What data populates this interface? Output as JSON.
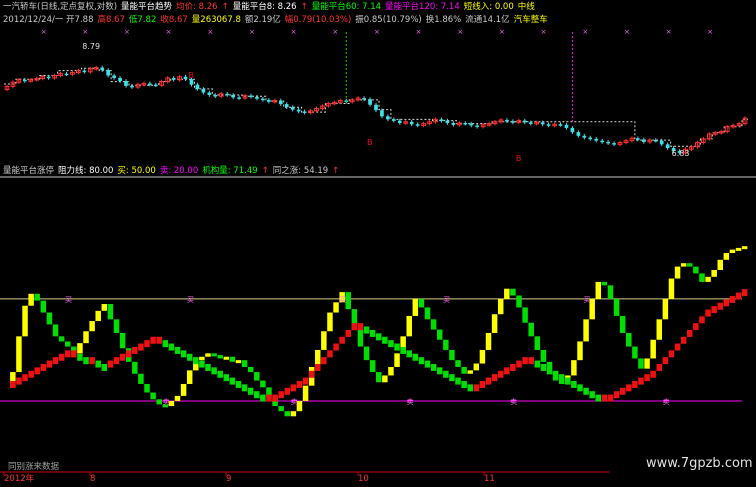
{
  "colors": {
    "background": "#000000",
    "up": "#ff3030",
    "down": "#40e0e8",
    "yellow": "#ffff00",
    "green": "#00dd00",
    "red": "#ee1111",
    "magenta": "#ff00ff",
    "pink": "#ff66ff",
    "resistance": "#d8d080",
    "divider": "#c8c8c8",
    "text": "#c0c0c0",
    "axis_red": "#cc0000"
  },
  "header": {
    "row1": [
      {
        "text": "一汽轿车(日线,定点复权,对数)",
        "color": "#c8c8c8"
      },
      {
        "text": "量能平台趋势",
        "color": "#ffffff"
      },
      {
        "text": "均价: 8.26",
        "color": "#ff3333"
      },
      {
        "text": "↑",
        "color": "#ff3333"
      },
      {
        "text": "量能平台8: 8.26",
        "color": "#ffffff"
      },
      {
        "text": "↑",
        "color": "#ff3333"
      },
      {
        "text": "量能平台60: 7.14",
        "color": "#00ff00"
      },
      {
        "text": "量能平台120: 7.14",
        "color": "#ff00ff"
      },
      {
        "text": "短线入: 0.00",
        "color": "#ffff00"
      },
      {
        "text": "中线",
        "color": "#ffff00"
      }
    ],
    "row2": [
      {
        "text": "2012/12/24/一 开7.88",
        "color": "#c8c8c8"
      },
      {
        "text": "高8.67",
        "color": "#ff3333"
      },
      {
        "text": "低7.82",
        "color": "#00ff00"
      },
      {
        "text": "收8.67",
        "color": "#ff3333"
      },
      {
        "text": "量263067.8",
        "color": "#ffff00"
      },
      {
        "text": "额2.19亿",
        "color": "#c8c8c8"
      },
      {
        "text": "幅0.79(10.03%)",
        "color": "#ff3333"
      },
      {
        "text": "振0.85(10.79%)",
        "color": "#c8c8c8"
      },
      {
        "text": "换1.86%",
        "color": "#c8c8c8"
      },
      {
        "text": "流通14.1亿",
        "color": "#c8c8c8"
      },
      {
        "text": "汽车整车",
        "color": "#ffff00"
      }
    ]
  },
  "lower_header": [
    {
      "text": "量能平台涨停",
      "color": "#c8c8c8"
    },
    {
      "text": "阻力线: 80.00",
      "color": "#ffffff"
    },
    {
      "text": "买: 50.00",
      "color": "#ffff00"
    },
    {
      "text": "卖: 20.00",
      "color": "#ff00ff"
    },
    {
      "text": "机构量: 71.49",
      "color": "#00ff00"
    },
    {
      "text": "↑",
      "color": "#ff3333"
    },
    {
      "text": "同之涨: 54.19",
      "color": "#c8c8c8"
    },
    {
      "text": "↑",
      "color": "#ff3333"
    }
  ],
  "annotations": {
    "price_high": "8.79",
    "price_low": "6.83",
    "signal_glyph": "B",
    "buy_glyph": "买",
    "sell_glyph": "卖",
    "bottom_left": "同别涨来数据",
    "watermark": "www.7gpzb.com",
    "x_ticks": [
      "2012年",
      "8",
      "9",
      "10",
      "11"
    ]
  },
  "chart_data": [
    {
      "type": "candlestick",
      "title": "一汽轿车(日线,定点复权,对数)",
      "x": "trading day index",
      "ylim": [
        6.7,
        8.9
      ],
      "close": [
        7.94,
        8.01,
        8.05,
        8.03,
        8.05,
        8.07,
        8.1,
        8.08,
        8.12,
        8.15,
        8.14,
        8.17,
        8.2,
        8.18,
        8.23,
        8.25,
        8.21,
        8.12,
        8.08,
        8.03,
        7.95,
        7.93,
        7.97,
        7.99,
        7.97,
        7.96,
        8.02,
        8.08,
        8.05,
        8.1,
        8.06,
        7.97,
        7.9,
        7.84,
        7.8,
        7.78,
        7.82,
        7.8,
        7.76,
        7.75,
        7.79,
        7.77,
        7.74,
        7.72,
        7.69,
        7.71,
        7.65,
        7.6,
        7.56,
        7.53,
        7.51,
        7.54,
        7.58,
        7.62,
        7.66,
        7.68,
        7.71,
        7.69,
        7.72,
        7.75,
        7.73,
        7.64,
        7.55,
        7.45,
        7.4,
        7.38,
        7.34,
        7.36,
        7.32,
        7.3,
        7.33,
        7.36,
        7.4,
        7.38,
        7.34,
        7.31,
        7.34,
        7.33,
        7.3,
        7.28,
        7.31,
        7.33,
        7.36,
        7.39,
        7.37,
        7.35,
        7.38,
        7.35,
        7.33,
        7.35,
        7.32,
        7.3,
        7.32,
        7.31,
        7.26,
        7.19,
        7.13,
        7.1,
        7.08,
        7.05,
        7.03,
        7.01,
        6.99,
        7.02,
        7.05,
        7.09,
        7.07,
        7.03,
        7.06,
        7.05,
        6.99,
        6.93,
        6.88,
        6.85,
        6.91,
        6.95,
        7.02,
        7.08,
        7.16,
        7.18,
        7.2,
        7.28,
        7.3,
        7.33,
        7.42
      ],
      "series": [
        {
          "name": "量能平台8",
          "values": [
            7.98,
            7.98,
            8.06,
            8.06,
            8.06,
            8.06,
            8.12,
            8.12,
            8.12,
            8.2,
            8.2,
            8.2,
            8.2,
            8.24,
            8.24,
            8.24,
            8.2,
            8.2,
            8.02,
            8.02,
            8.02,
            7.96,
            7.96,
            7.96,
            7.96,
            7.96,
            8.02,
            8.02,
            8.06,
            8.06,
            8.06,
            8.06,
            7.9,
            7.9,
            7.9,
            7.8,
            7.8,
            7.8,
            7.8,
            7.8,
            7.78,
            7.78,
            7.78,
            7.78,
            7.7,
            7.7,
            7.7,
            7.6,
            7.6,
            7.6,
            7.52,
            7.52,
            7.52,
            7.52,
            7.66,
            7.66,
            7.66,
            7.66,
            7.72,
            7.72,
            7.72,
            7.72,
            7.72,
            7.56,
            7.56,
            7.4,
            7.4,
            7.4,
            7.4,
            7.4,
            7.4,
            7.4,
            7.38,
            7.38,
            7.38,
            7.38,
            7.33,
            7.33,
            7.33,
            7.33,
            7.33,
            7.33,
            7.36,
            7.36,
            7.36,
            7.36,
            7.36,
            7.36,
            7.36,
            7.36,
            7.36,
            7.36,
            7.36,
            7.36,
            7.36,
            7.36,
            7.36,
            7.36,
            7.36,
            7.36,
            7.36,
            7.36,
            7.36,
            7.36,
            7.36,
            7.36,
            7.06,
            7.06,
            7.06,
            7.06,
            7.06,
            7.06,
            6.96,
            6.96,
            6.96,
            6.96,
            6.96,
            7.08,
            7.08,
            7.18,
            7.18,
            7.28,
            7.28,
            7.28,
            7.4
          ]
        }
      ]
    },
    {
      "type": "line",
      "title": "量能平台涨停",
      "ylim": [
        0,
        100
      ],
      "reference_lines": {
        "阻力线": 80,
        "买": 50,
        "卖": 20
      },
      "series": [
        {
          "name": "机构量",
          "values": [
            28,
            37,
            58,
            76,
            83,
            79,
            72,
            65,
            58,
            55,
            52,
            48,
            54,
            61,
            67,
            73,
            77,
            68,
            60,
            51,
            43,
            36,
            30,
            25,
            21,
            18,
            17,
            20,
            23,
            30,
            38,
            44,
            46,
            48,
            47,
            45,
            46,
            43,
            44,
            40,
            37,
            32,
            28,
            22,
            17,
            14,
            11,
            14,
            20,
            29,
            40,
            50,
            61,
            72,
            78,
            84,
            74,
            62,
            52,
            44,
            37,
            31,
            35,
            40,
            48,
            58,
            70,
            80,
            75,
            68,
            62,
            56,
            50,
            44,
            40,
            36,
            38,
            42,
            50,
            60,
            71,
            80,
            86,
            82,
            75,
            66,
            58,
            50,
            43,
            37,
            32,
            30,
            35,
            44,
            55,
            68,
            80,
            90,
            88,
            80,
            70,
            60,
            52,
            45,
            39,
            45,
            56,
            68,
            80,
            92,
            99,
            101,
            99,
            95,
            90,
            93,
            97,
            103,
            107,
            109,
            110,
            111
          ]
        },
        {
          "name": "同之涨",
          "values": [
            28,
            30,
            32,
            34,
            36,
            38,
            40,
            42,
            44,
            46,
            48,
            48,
            46,
            44,
            44,
            42,
            40,
            42,
            44,
            46,
            48,
            50,
            52,
            54,
            56,
            56,
            54,
            52,
            50,
            48,
            46,
            44,
            42,
            40,
            38,
            36,
            34,
            32,
            30,
            28,
            26,
            24,
            22,
            22,
            22,
            24,
            26,
            28,
            30,
            32,
            36,
            40,
            44,
            48,
            52,
            56,
            60,
            64,
            64,
            62,
            60,
            58,
            56,
            54,
            52,
            50,
            48,
            46,
            44,
            42,
            40,
            38,
            36,
            34,
            32,
            30,
            28,
            28,
            30,
            32,
            34,
            36,
            38,
            40,
            42,
            44,
            44,
            42,
            40,
            38,
            36,
            34,
            32,
            30,
            28,
            26,
            24,
            22,
            22,
            22,
            24,
            26,
            28,
            30,
            32,
            34,
            36,
            40,
            44,
            48,
            52,
            56,
            60,
            64,
            68,
            72,
            74,
            76,
            78,
            80,
            82,
            84
          ]
        }
      ]
    }
  ]
}
